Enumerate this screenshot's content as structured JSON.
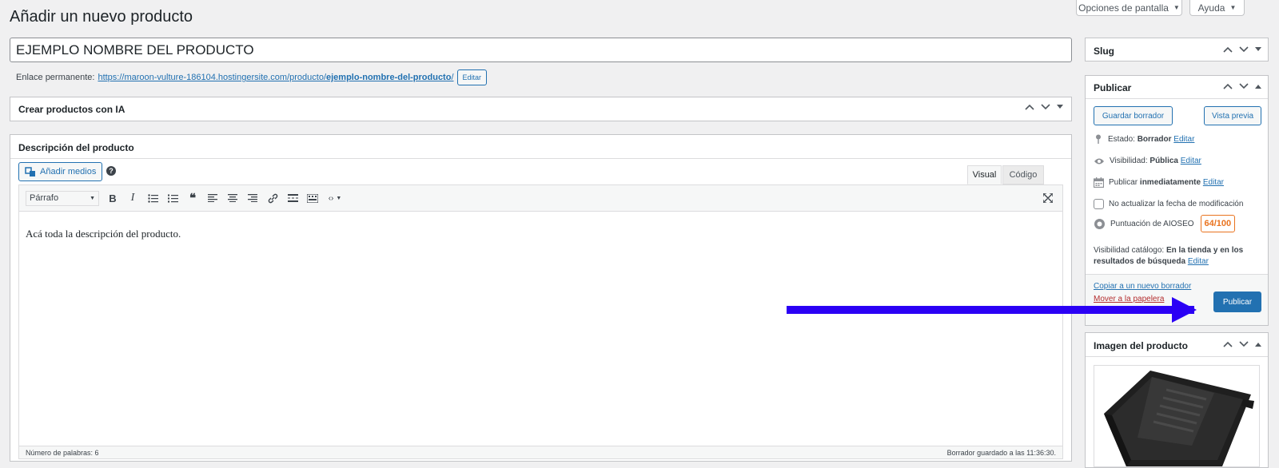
{
  "header": {
    "title": "Añadir un nuevo producto",
    "screen_options": "Opciones de pantalla",
    "help": "Ayuda"
  },
  "product": {
    "title_value": "EJEMPLO NOMBRE DEL PRODUCTO",
    "permalink_label": "Enlace permanente:",
    "permalink_base": "https://maroon-vulture-186104.hostingersite.com/producto/",
    "permalink_slug": "ejemplo-nombre-del-producto",
    "permalink_slash": "/",
    "edit_button": "Editar"
  },
  "ai_box": {
    "title": "Crear productos con IA"
  },
  "description_box": {
    "title": "Descripción del producto",
    "add_media": "Añadir medios",
    "tab_visual": "Visual",
    "tab_code": "Código",
    "format_select": "Párrafo",
    "content": "Acá toda la descripción del producto.",
    "word_count": "Número de palabras: 6",
    "draft_saved": "Borrador guardado a las 11:36:30."
  },
  "sidebar": {
    "slug_title": "Slug",
    "publish": {
      "title": "Publicar",
      "save_draft": "Guardar borrador",
      "preview": "Vista previa",
      "status_label": "Estado:",
      "status_value": "Borrador",
      "visibility_label": "Visibilidad:",
      "visibility_value": "Pública",
      "publish_label": "Publicar",
      "publish_value": "inmediatamente",
      "edit": "Editar",
      "no_update_date": "No actualizar la fecha de modificación",
      "aioseo_label": "Puntuación de AIOSEO",
      "aioseo_score": "64/100",
      "catalog_label": "Visibilidad catálogo:",
      "catalog_value_1": "En la tienda y en los",
      "catalog_value_2": "resultados de búsqueda",
      "copy_draft": "Copiar a un nuevo borrador",
      "trash_partial": "Mover a la papelera",
      "publish_button": "Publicar"
    },
    "image_title": "Imagen del producto"
  },
  "colors": {
    "accent": "#2271b1",
    "arrow": "#2b00f5",
    "score": "#e9731f"
  }
}
